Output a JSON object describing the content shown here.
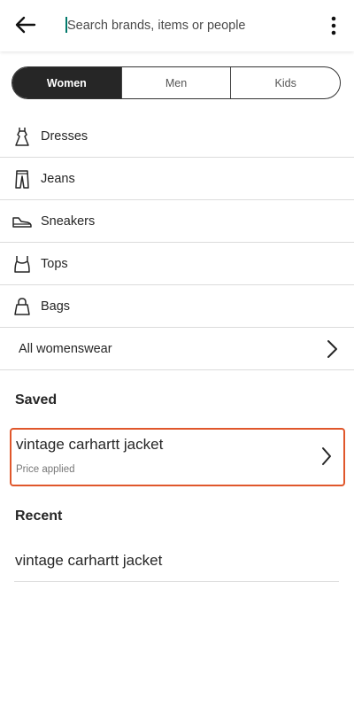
{
  "search": {
    "placeholder": "Search brands, items or people"
  },
  "icons": {
    "back": "arrow-left-icon",
    "more": "more-vertical-icon"
  },
  "segments": [
    {
      "label": "Women",
      "active": true
    },
    {
      "label": "Men",
      "active": false
    },
    {
      "label": "Kids",
      "active": false
    }
  ],
  "categories": [
    {
      "label": "Dresses",
      "icon": "dress-icon"
    },
    {
      "label": "Jeans",
      "icon": "jeans-icon"
    },
    {
      "label": "Sneakers",
      "icon": "sneaker-icon"
    },
    {
      "label": "Tops",
      "icon": "top-icon"
    },
    {
      "label": "Bags",
      "icon": "bag-icon"
    }
  ],
  "all_link": {
    "label": "All womenswear"
  },
  "saved": {
    "title": "Saved",
    "items": [
      {
        "label": "vintage carhartt jacket",
        "subtitle": "Price applied"
      }
    ]
  },
  "recent": {
    "title": "Recent",
    "items": [
      {
        "label": "vintage carhartt jacket"
      }
    ]
  },
  "colors": {
    "highlight_border": "#e0572b",
    "active_segment": "#262626",
    "caret": "#00796b"
  }
}
